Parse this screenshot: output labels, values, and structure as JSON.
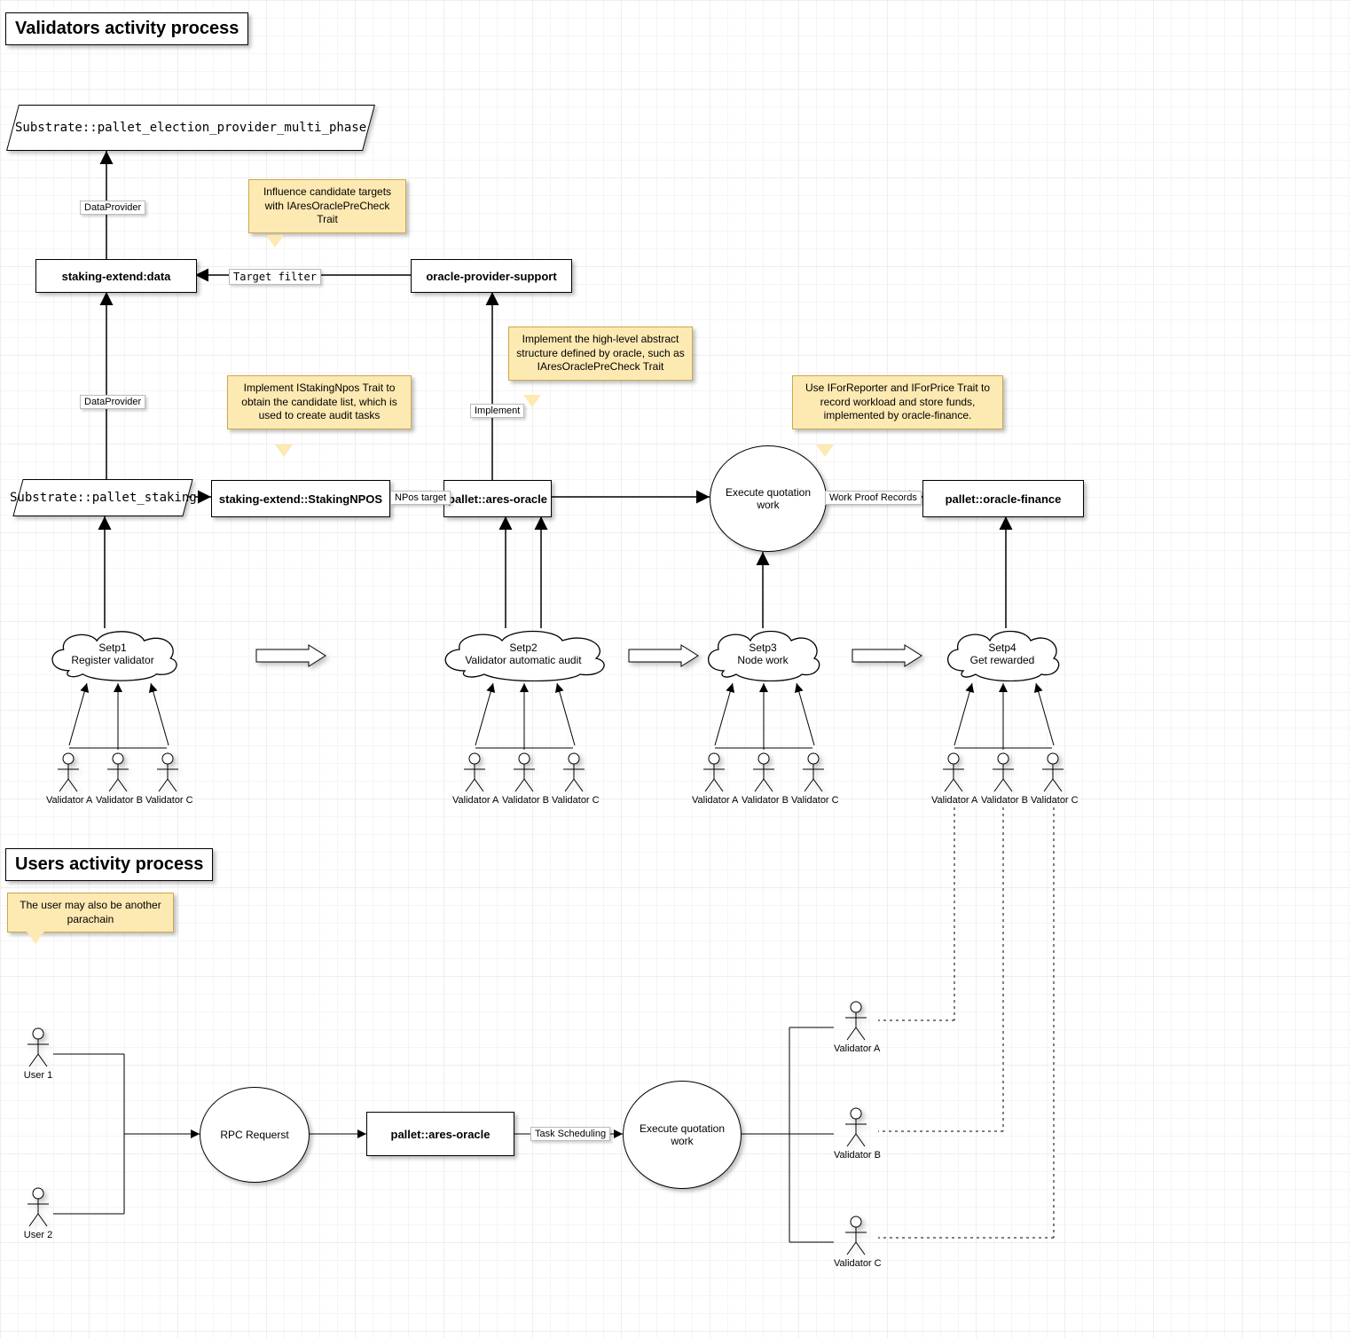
{
  "titles": {
    "validators": "Validators activity process",
    "users": "Users activity process"
  },
  "boxes": {
    "epmp": "Substrate::pallet_election_provider_multi_phase",
    "stakingExtendData": "staking-extend:data",
    "oracleProviderSupport": "oracle-provider-support",
    "palletStaking": "Substrate::pallet_staking",
    "stakingNPOS": "staking-extend::StakingNPOS",
    "aresOracleTop": "pallet::ares-oracle",
    "oracleFinance": "pallet::oracle-finance",
    "rpcRequest": "RPC Requerst",
    "aresOracleBottom": "pallet::ares-oracle",
    "execQuoteTop": "Execute quotation work",
    "execQuoteBottom": "Execute quotation work"
  },
  "notes": {
    "influence": "Influence candidate targets with IAresOraclePreCheck Trait",
    "implementNpos": "Implement IStakingNpos Trait to obtain the candidate list, which is used to create audit tasks",
    "implementOracle": "Implement the high-level abstract structure defined by oracle, such as IAresOraclePreCheck Trait",
    "useIFor": "Use IForReporter and IForPrice Trait to record workload and store funds, implemented by oracle-finance.",
    "userParachain": "The user may also be another parachain"
  },
  "edges": {
    "dataProvider": "DataProvider",
    "targetFilter": "Target filter",
    "nposTarget": "NPos target",
    "implement": "Implement",
    "workProof": "Work Proof Records",
    "taskScheduling": "Task Scheduling"
  },
  "clouds": {
    "step1": {
      "line1": "Setp1",
      "line2": "Register validator"
    },
    "step2": {
      "line1": "Setp2",
      "line2": "Validator automatic audit"
    },
    "step3": {
      "line1": "Setp3",
      "line2": "Node work"
    },
    "step4": {
      "line1": "Setp4",
      "line2": "Get rewarded"
    }
  },
  "actors": {
    "va": "Validator A",
    "vb": "Validator B",
    "vc": "Validator C",
    "u1": "User 1",
    "u2": "User 2"
  }
}
